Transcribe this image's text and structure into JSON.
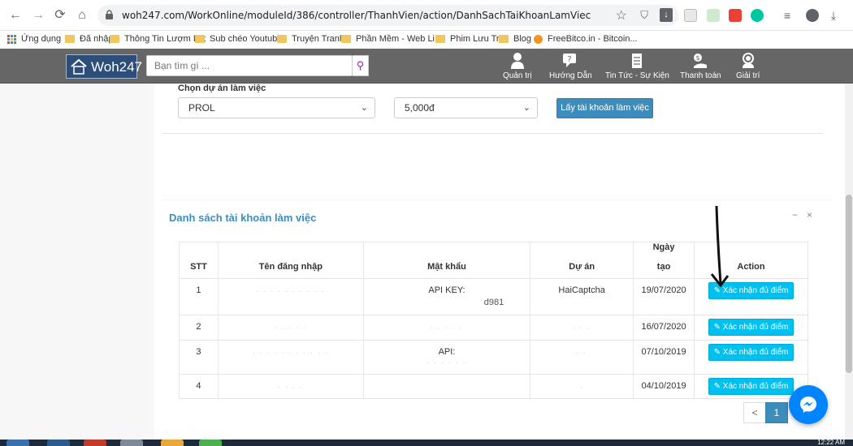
{
  "browser": {
    "url": "woh247.com/WorkOnline/moduleId/386/controller/ThanhVien/action/DanhSachTaiKhoanLamViec",
    "bookmarks": [
      {
        "label": "Ứng dụng",
        "icon": "apps-grid-icon"
      },
      {
        "label": "Đã nhập",
        "icon": "folder-icon"
      },
      {
        "label": "Thông Tin Lượm Lặt",
        "icon": "folder-icon"
      },
      {
        "label": "Sub chéo Youtube",
        "icon": "folder-icon"
      },
      {
        "label": "Truyện Tranh",
        "icon": "folder-icon"
      },
      {
        "label": "Phần Mềm - Web Li...",
        "icon": "folder-icon"
      },
      {
        "label": "Phim Lưu Trữ",
        "icon": "folder-icon"
      },
      {
        "label": "Blog",
        "icon": "folder-icon"
      },
      {
        "label": "FreeBitco.in - Bitcoin...",
        "icon": "bitcoin-icon"
      }
    ]
  },
  "site": {
    "logo_text": "Woh247",
    "search_placeholder": "Bạn tìm gì ...",
    "menu": [
      {
        "label": "Quản trị",
        "icon": "user-icon"
      },
      {
        "label": "Hướng Dẫn",
        "icon": "help-chat-icon"
      },
      {
        "label": "Tin Tức - Sự Kiện",
        "icon": "news-icon"
      },
      {
        "label": "Thanh toán",
        "icon": "payment-icon"
      },
      {
        "label": "Giải trí",
        "icon": "headset-icon"
      }
    ]
  },
  "project_select": {
    "label": "Chọn dự án làm việc",
    "project_value": "PROL",
    "amount_value": "5,000đ",
    "submit_label": "Lấy tài khoản làm việc"
  },
  "accounts": {
    "title": "Danh sách tài khoản làm việc",
    "collapse_label": "−",
    "close_label": "×",
    "headers": {
      "stt": "STT",
      "username": "Tên đăng nhập",
      "password": "Mật khẩu",
      "project": "Dự án",
      "date_line1": "Ngày",
      "date_line2": "tạo",
      "action": "Action"
    },
    "rows": [
      {
        "stt": "1",
        "username": "",
        "password": "API KEY:",
        "password_tail": "d981",
        "project": "HaiCaptcha",
        "date": "19/07/2020",
        "action": "Xác nhận đủ điểm"
      },
      {
        "stt": "2",
        "username": "",
        "password": "",
        "password_tail": "",
        "project": "",
        "date": "16/07/2020",
        "action": "Xác nhận đủ điểm"
      },
      {
        "stt": "3",
        "username": "",
        "password": "API:",
        "password_tail": "",
        "project": "",
        "date": "07/10/2019",
        "action": "Xác nhận đủ điểm"
      },
      {
        "stt": "4",
        "username": "",
        "password": "",
        "password_tail": "",
        "project": "",
        "date": "04/10/2019",
        "action": "Xác nhận đủ điểm"
      }
    ],
    "pagination": {
      "prev": "<",
      "current": "1"
    }
  },
  "taskbar": {
    "clock": "12:22 AM"
  },
  "colors": {
    "header_bg": "#666666",
    "primary": "#3c8dbc",
    "info": "#00c0ef",
    "messenger": "#0084ff"
  }
}
